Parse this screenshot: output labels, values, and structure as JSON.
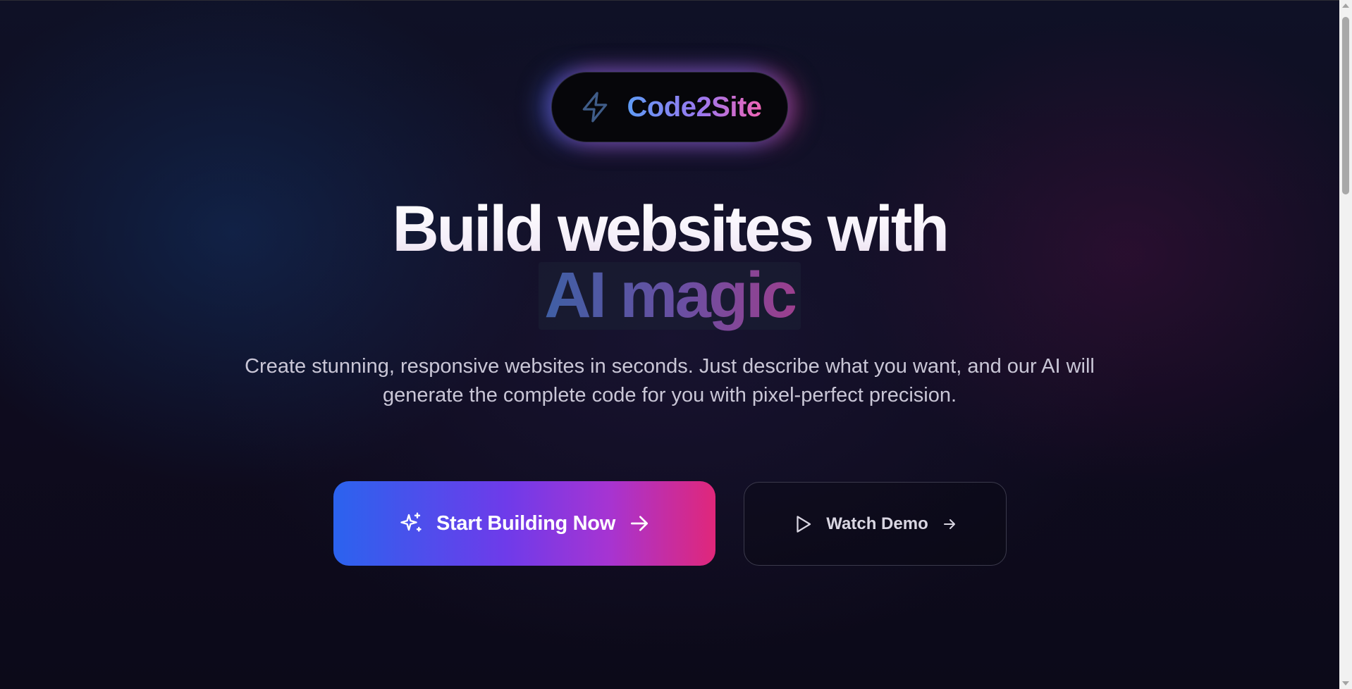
{
  "brand": {
    "name": "Code2Site",
    "icon": "lightning-bolt-icon"
  },
  "hero": {
    "headline_line1": "Build websites with",
    "headline_line2": "AI magic",
    "subtitle": "Create stunning, responsive websites in seconds. Just describe what you want, and our AI will generate the complete code for you with pixel-perfect precision."
  },
  "actions": {
    "primary": {
      "label": "Start Building Now",
      "leading_icon": "sparkles-icon",
      "trailing_icon": "arrow-right-icon"
    },
    "secondary": {
      "label": "Watch Demo",
      "leading_icon": "play-icon",
      "trailing_icon": "arrow-right-icon"
    }
  },
  "colors": {
    "background": "#0d0b1a",
    "brand_gradient_start": "#5e9bf5",
    "brand_gradient_end": "#f064b4",
    "primary_button_start": "#2b63ee",
    "primary_button_end": "#e0277a"
  }
}
